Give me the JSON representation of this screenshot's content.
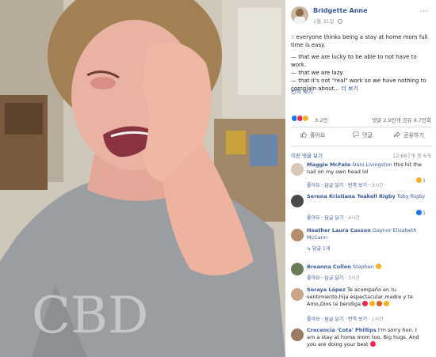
{
  "post": {
    "author": "Bridgette Anne",
    "date": "1월 31일",
    "text_lines": [
      "☝ everyone thinks being a stay at home mom full time is easy.",
      "— that we are lucky to be able to not have to work.",
      "— that we are lazy.",
      "— that it's not \"real\" work so we have nothing to complain about..."
    ],
    "see_more": "더 보기",
    "see_translation": "번역 보기",
    "reaction_count": "3.2만",
    "comments_shares": "댓글 2.9만개  공유 8.7만회",
    "actions": {
      "like": "좋아요",
      "comment": "댓글",
      "share": "공유하기"
    }
  },
  "comments_header": {
    "previous": "이전 댓글 보기",
    "count": "12,667개 중 6개"
  },
  "comment_actions": {
    "like": "좋아요",
    "reply": "답글 달기",
    "translate": "번역 보기"
  },
  "comments": [
    {
      "name": "Maggie McFate",
      "tag": "Dani Livingston",
      "text": "this hit the nail on my own head lol",
      "time": "3시간",
      "replies": ""
    },
    {
      "name": "Serena Kristiana Teakell Rigby",
      "tag": "Toby Rigby",
      "text": "",
      "time": "4시간",
      "replies": ""
    },
    {
      "name": "Heather Laura Casson",
      "tag": "Gaynor Elizabeth McCann",
      "text": "",
      "time": "",
      "replies": "답글 1개"
    },
    {
      "name": "Breanna Cullen",
      "tag": "Stephen",
      "text": "",
      "time": "3시간",
      "replies": ""
    },
    {
      "name": "Soraya López",
      "tag": "",
      "text": "Te acompaño en tu sentimiento,hija espectacular,madre y te Amo,Dios te bendiga",
      "time": "1시간",
      "replies": ""
    },
    {
      "name": "Crecencia 'Cota' Phillips",
      "tag": "",
      "text": "I'm sorry hon. I am a stay at home mom too. Big hugs. And you are doing your best",
      "time": "",
      "replies": ""
    }
  ],
  "mini_reactions": {
    "c1": "1",
    "c2": "1"
  },
  "colors": {
    "link": "#385898",
    "like_blue": "#1877f2",
    "love_red": "#f0284a",
    "haha_yellow": "#f7b125",
    "divider": "#dadde1"
  }
}
